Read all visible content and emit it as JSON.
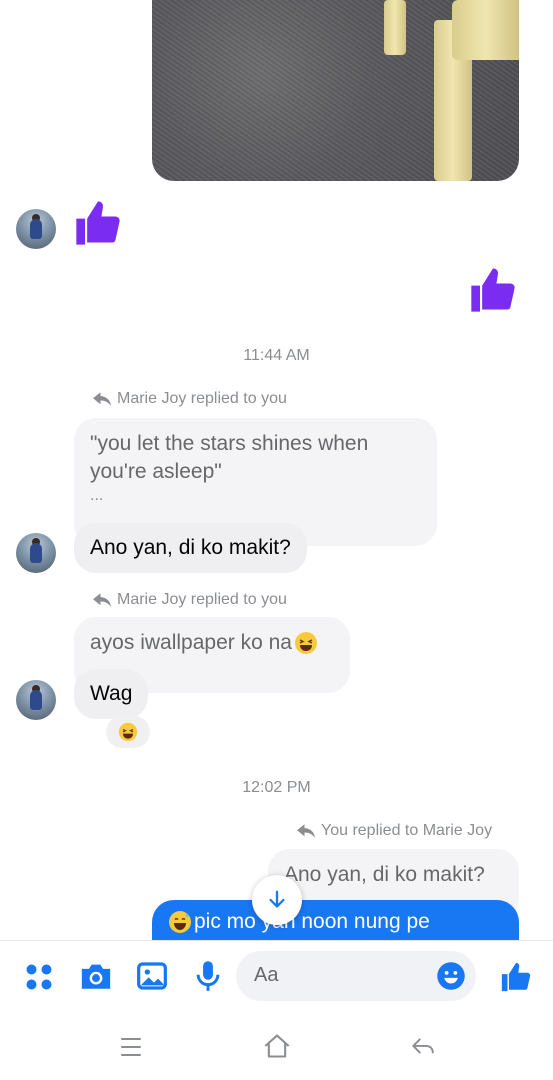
{
  "messages": {
    "time_1": "11:44 AM",
    "reply_label_1": "Marie Joy replied to you",
    "quoted_1": "\"you let the stars shines when you're asleep\"",
    "quoted_1_ellipsis": "...",
    "msg_1": "Ano yan,  di ko makit?",
    "reply_label_2": "Marie Joy replied to you",
    "quoted_2": "ayos iwallpaper ko na",
    "msg_2": "Wag",
    "time_2": "12:02 PM",
    "reply_label_3": "You replied to Marie Joy",
    "quoted_3": "Ano yan,  di ko makit?",
    "sent_msg": "pic mo yan noon nung pe"
  },
  "composer": {
    "placeholder": "Aa"
  },
  "colors": {
    "accent": "#1877f2",
    "like_purple": "#7a2cf0"
  },
  "icons": [
    "apps-icon",
    "camera-icon",
    "image-icon",
    "microphone-icon",
    "emoji-icon",
    "like-icon",
    "menu-icon",
    "home-icon",
    "back-icon",
    "scroll-down-icon"
  ]
}
